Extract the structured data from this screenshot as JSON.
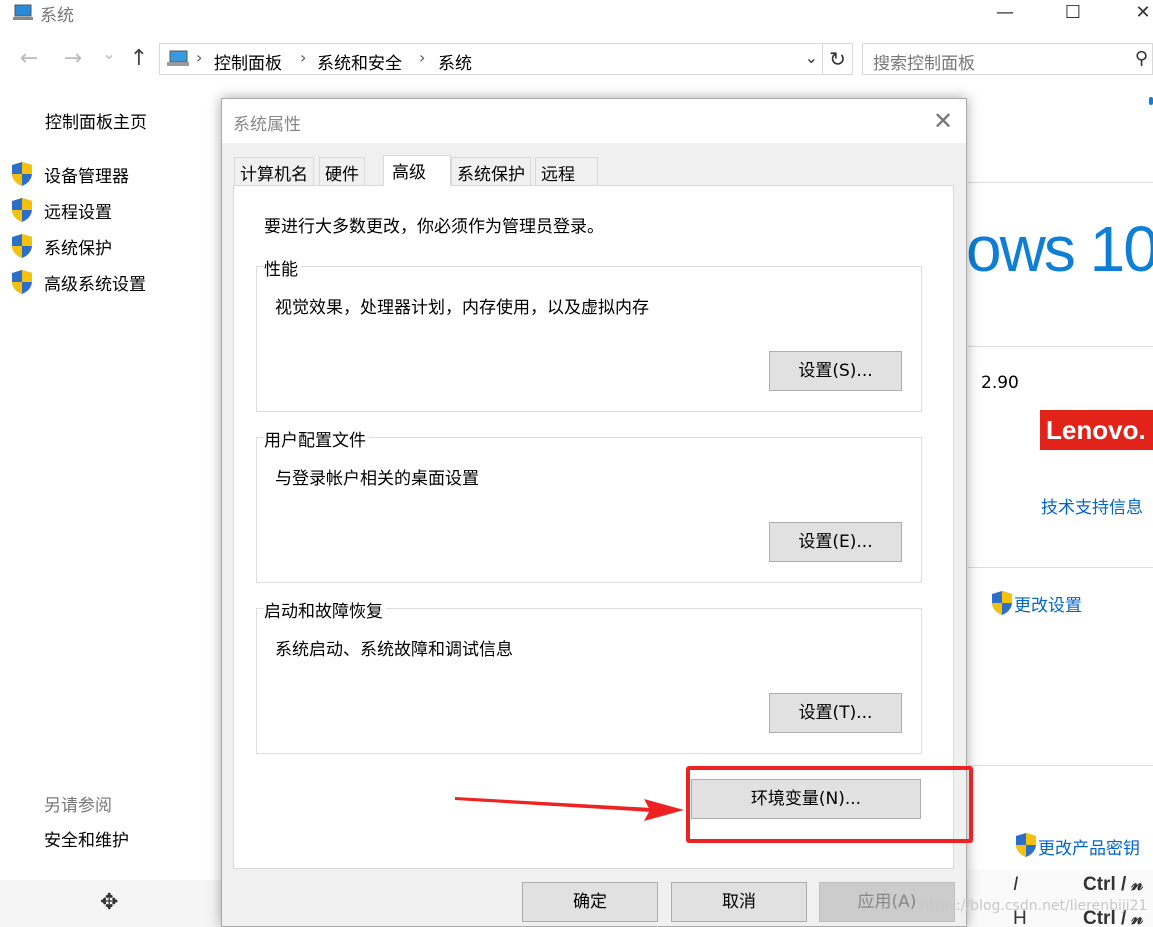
{
  "window": {
    "title": "系统",
    "minimize_glyph": "—",
    "maximize_glyph": "☐",
    "close_glyph": "✕"
  },
  "nav": {
    "back_glyph": "←",
    "forward_glyph": "→",
    "history_glyph": "⌄",
    "up_glyph": "↑",
    "breadcrumb": [
      "控制面板",
      "系统和安全",
      "系统"
    ],
    "separator": "›",
    "dropdown_glyph": "⌄",
    "refresh_glyph": "↻"
  },
  "search": {
    "placeholder": "搜索控制面板",
    "icon_glyph": "⚲"
  },
  "sidebar": {
    "home_label": "控制面板主页",
    "items": [
      {
        "label": "设备管理器",
        "icon": "uac-shield-icon"
      },
      {
        "label": "远程设置",
        "icon": "uac-shield-icon"
      },
      {
        "label": "系统保护",
        "icon": "uac-shield-icon"
      },
      {
        "label": "高级系统设置",
        "icon": "uac-shield-icon"
      }
    ],
    "see_also_label": "另请参阅",
    "security_label": "安全和维护"
  },
  "background": {
    "windows_logo_text": "ows 10",
    "cpu_speed": "2.90",
    "lenovo_text": "Lenovo.",
    "support_link": "技术支持信息",
    "change_settings_link": "更改设置",
    "change_key_link": "更改产品密钥",
    "move_glyph": "✥",
    "shortcut_1_key": "I",
    "shortcut_1_combo": "Ctrl / 𝓃",
    "shortcut_2_key": "H",
    "shortcut_2_combo": "Ctrl / 𝓃",
    "watermark": "https://blog.csdn.net/lierenbiji21"
  },
  "dialog": {
    "title": "系统属性",
    "close_glyph": "✕",
    "tabs": [
      {
        "label": "计算机名",
        "active": false
      },
      {
        "label": "硬件",
        "active": false
      },
      {
        "label": "高级",
        "active": true
      },
      {
        "label": "系统保护",
        "active": false
      },
      {
        "label": "远程",
        "active": false
      }
    ],
    "admin_note": "要进行大多数更改，你必须作为管理员登录。",
    "groups": [
      {
        "title": "性能",
        "description": "视觉效果，处理器计划，内存使用，以及虚拟内存",
        "button": "设置(S)..."
      },
      {
        "title": "用户配置文件",
        "description": "与登录帐户相关的桌面设置",
        "button": "设置(E)..."
      },
      {
        "title": "启动和故障恢复",
        "description": "系统启动、系统故障和调试信息",
        "button": "设置(T)..."
      }
    ],
    "env_button": "环境变量(N)...",
    "ok_button": "确定",
    "cancel_button": "取消",
    "apply_button": "应用(A)",
    "highlight_color": "#ee2222"
  }
}
